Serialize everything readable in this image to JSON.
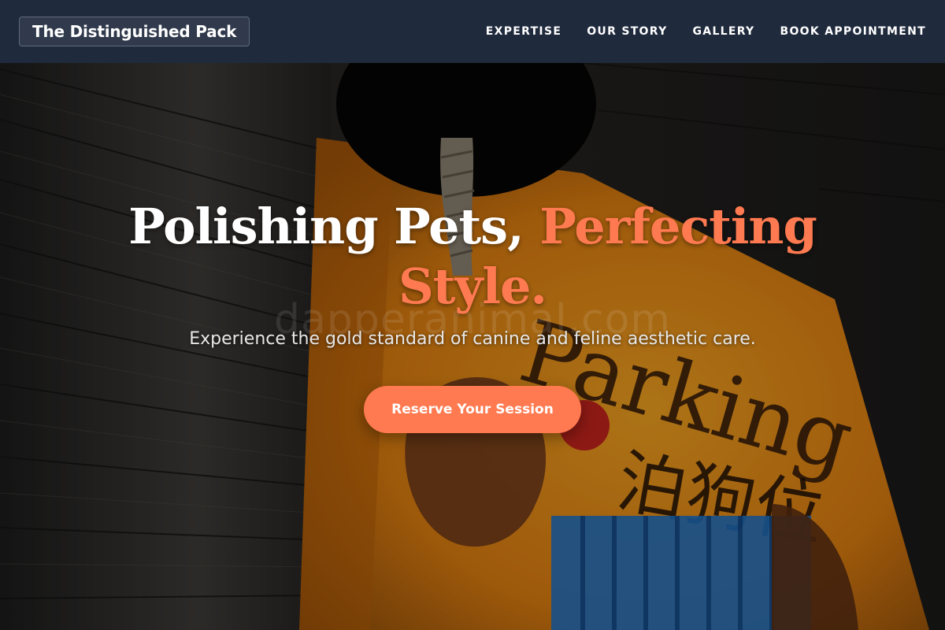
{
  "header": {
    "brand": "The Distinguished Pack",
    "nav": [
      {
        "label": "EXPERTISE"
      },
      {
        "label": "OUR STORY"
      },
      {
        "label": "GALLERY"
      },
      {
        "label": "BOOK APPOINTMENT"
      }
    ]
  },
  "hero": {
    "headline_main": "Polishing Pets, ",
    "headline_accent": "Perfecting Style.",
    "subheadline": "Experience the gold standard of canine and feline aesthetic care.",
    "cta_label": "Reserve Your Session",
    "watermark": "dapperanimal.com",
    "sign_text_en": "Parking",
    "sign_text_cn": "泊狗位"
  },
  "colors": {
    "header_bg": "#1f2a3d",
    "accent": "#ff7a50",
    "text_light": "#ffffff"
  }
}
